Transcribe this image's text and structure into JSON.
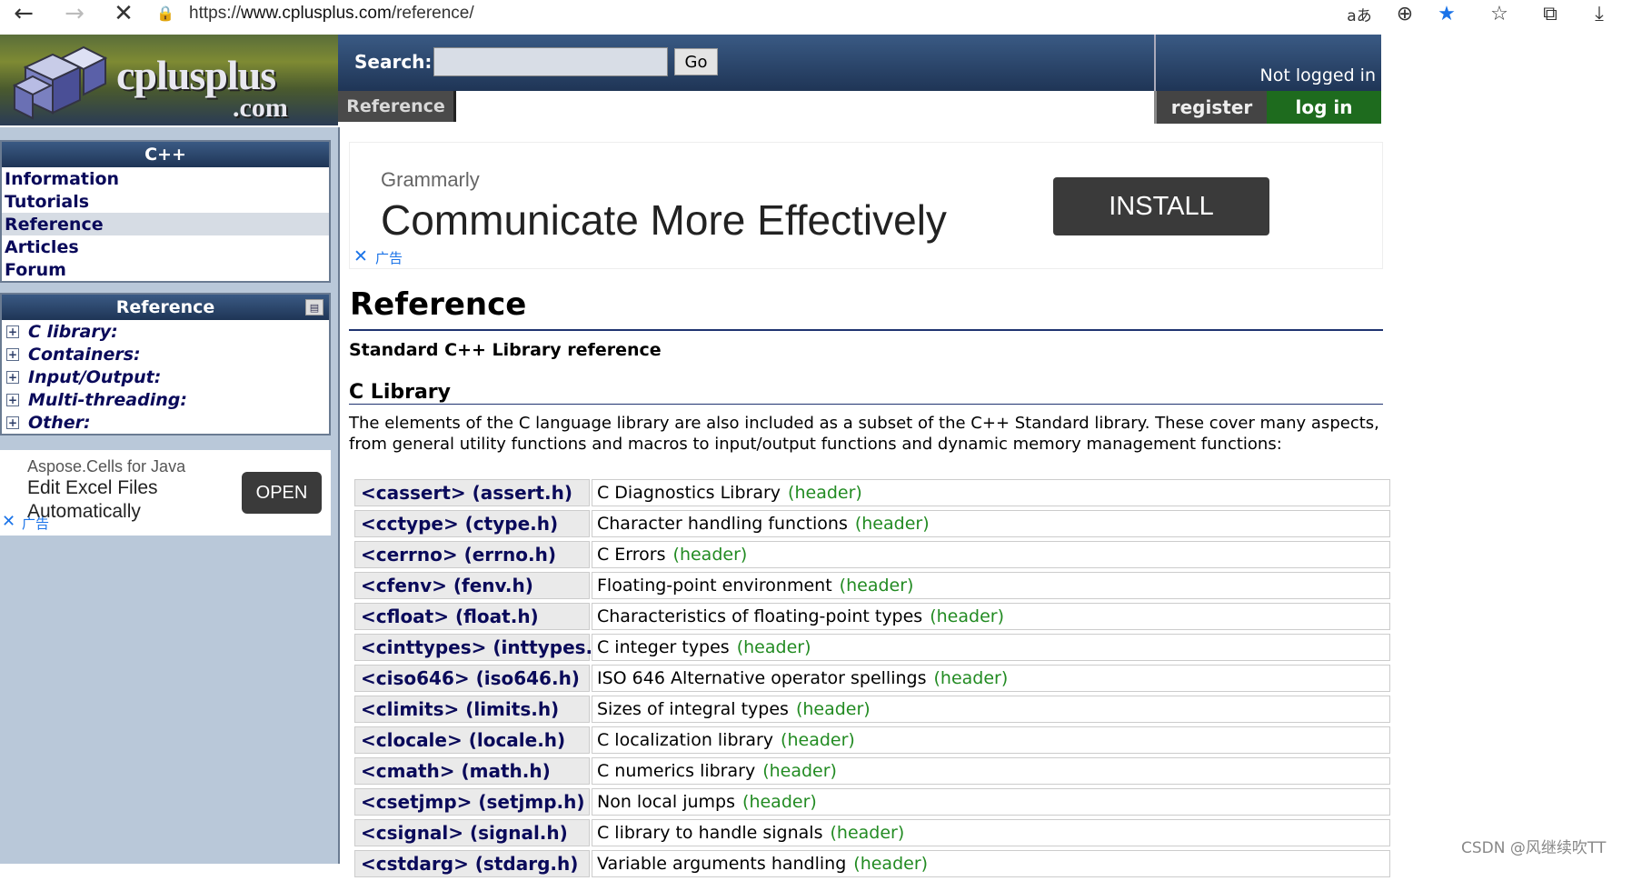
{
  "browser": {
    "url_prefix": "https://",
    "url_host": "www.cplusplus.com",
    "url_path": "/reference/",
    "back_glyph": "←",
    "forward_glyph": "→",
    "stop_glyph": "✕",
    "lock_glyph": "🔒",
    "right_icons": [
      "aあ",
      "⊕",
      "★",
      "☆",
      "⧉",
      "⤓"
    ]
  },
  "header": {
    "logo_word": "cplusplus",
    "logo_dotcom": ".com",
    "search_label": "Search:",
    "search_value": "",
    "go_label": "Go",
    "not_logged_in": "Not logged in",
    "reference_tab": "Reference",
    "register_label": "register",
    "login_label": "log in"
  },
  "sidebar": {
    "cpp_title": "C++",
    "nav_items": [
      {
        "label": "Information"
      },
      {
        "label": "Tutorials"
      },
      {
        "label": "Reference"
      },
      {
        "label": "Articles"
      },
      {
        "label": "Forum"
      }
    ],
    "reference_title": "Reference",
    "tree_items": [
      {
        "label": "C library:"
      },
      {
        "label": "Containers:"
      },
      {
        "label": "Input/Output:"
      },
      {
        "label": "Multi-threading:"
      },
      {
        "label": "Other:"
      }
    ],
    "ad": {
      "brand": "Aspose.Cells for Java",
      "line1": "Edit Excel Files",
      "line2": "Automatically",
      "button": "OPEN",
      "close": "✕",
      "tag": "广告"
    }
  },
  "top_ad": {
    "brand": "Grammarly",
    "headline": "Communicate More Effectively",
    "button": "INSTALL",
    "close": "✕",
    "tag": "广告"
  },
  "main": {
    "title": "Reference",
    "subtitle": "Standard C++ Library reference",
    "section_title": "C Library",
    "intro": "The elements of the C language library are also included as a subset of the C++ Standard library. These cover many aspects, from general utility functions and macros to input/output functions and dynamic memory management functions:",
    "rows": [
      {
        "name": "<cassert> (assert.h)",
        "desc": "C Diagnostics Library",
        "kind": "(header)"
      },
      {
        "name": "<cctype> (ctype.h)",
        "desc": "Character handling functions",
        "kind": "(header)"
      },
      {
        "name": "<cerrno> (errno.h)",
        "desc": "C Errors",
        "kind": "(header)"
      },
      {
        "name": "<cfenv> (fenv.h)",
        "desc": "Floating-point environment",
        "kind": "(header)"
      },
      {
        "name": "<cfloat> (float.h)",
        "desc": "Characteristics of floating-point types",
        "kind": "(header)"
      },
      {
        "name": "<cinttypes> (inttypes.h)",
        "desc": "C integer types",
        "kind": "(header)"
      },
      {
        "name": "<ciso646> (iso646.h)",
        "desc": "ISO 646 Alternative operator spellings",
        "kind": "(header)"
      },
      {
        "name": "<climits> (limits.h)",
        "desc": "Sizes of integral types",
        "kind": "(header)"
      },
      {
        "name": "<clocale> (locale.h)",
        "desc": "C localization library",
        "kind": "(header)"
      },
      {
        "name": "<cmath> (math.h)",
        "desc": "C numerics library",
        "kind": "(header)"
      },
      {
        "name": "<csetjmp> (setjmp.h)",
        "desc": "Non local jumps",
        "kind": "(header)"
      },
      {
        "name": "<csignal> (signal.h)",
        "desc": "C library to handle signals",
        "kind": "(header)"
      },
      {
        "name": "<cstdarg> (stdarg.h)",
        "desc": "Variable arguments handling",
        "kind": "(header)"
      }
    ]
  },
  "watermark": "CSDN @风继续吹TT"
}
